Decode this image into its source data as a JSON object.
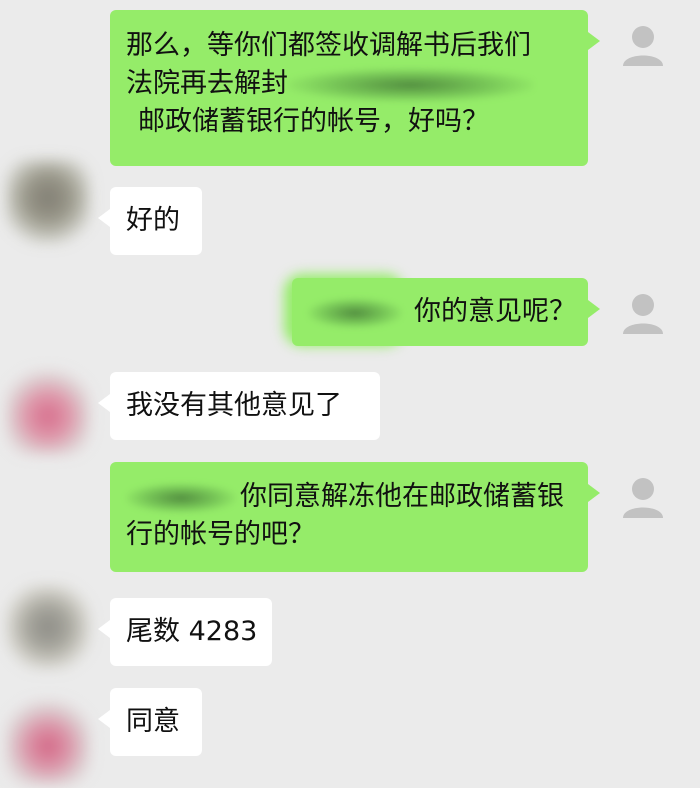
{
  "colors": {
    "background": "#ebebeb",
    "outgoing_bubble": "#95ec69",
    "incoming_bubble": "#ffffff",
    "text": "#111111",
    "default_avatar": "#c2c2c2"
  },
  "messages": [
    {
      "direction": "outgoing",
      "lines": [
        "那么，等你们都签收调解书后我们",
        "法院再去解封",
        "邮政储蓄银行的帐号，好吗？"
      ],
      "redacted": true
    },
    {
      "direction": "incoming",
      "lines": [
        "好的"
      ]
    },
    {
      "direction": "outgoing",
      "lines": [
        "你的意见呢？"
      ],
      "redacted": true
    },
    {
      "direction": "incoming",
      "lines": [
        "我没有其他意见了"
      ]
    },
    {
      "direction": "outgoing",
      "lines": [
        "你同意解冻他在邮政储蓄银",
        "行的帐号的吧？"
      ],
      "redacted": true
    },
    {
      "direction": "incoming",
      "lines": [
        "尾数 4283"
      ]
    },
    {
      "direction": "incoming",
      "lines": [
        "同意"
      ]
    }
  ],
  "icons": {
    "self_avatar": "default-person-icon",
    "contact_avatar": "blurred-avatar"
  }
}
